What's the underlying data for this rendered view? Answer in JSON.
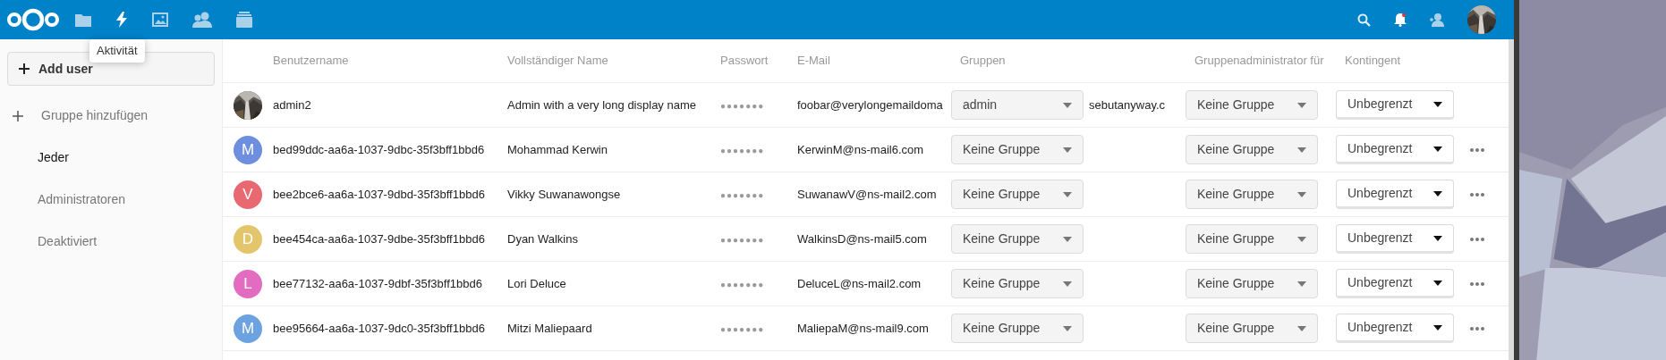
{
  "tooltip": "Aktivität",
  "sidebar": {
    "add_button": "Add user",
    "add_group": "Gruppe hinzufügen",
    "items": [
      {
        "label": "Jeder",
        "selected": true
      },
      {
        "label": "Administratoren",
        "selected": false
      },
      {
        "label": "Deaktiviert",
        "selected": false
      }
    ]
  },
  "table": {
    "columns": [
      "Benutzername",
      "Vollständiger Name",
      "Passwort",
      "E-Mail",
      "Gruppen",
      "Gruppenadministrator für",
      "Kontingent"
    ],
    "rows": [
      {
        "username": "admin2",
        "full_name": "Admin with a very long display name",
        "password": "●●●●●●●",
        "email": "foobar@verylongemaildoma",
        "email_overflow": "sebutanyway.c",
        "groups": "admin",
        "group_admin": "Keine Gruppe",
        "quota": "Unbegrenzt",
        "menu": false
      },
      {
        "avatar": {
          "kind": "letter",
          "letter": "M",
          "color": "#6e8fe0"
        },
        "username": "bed99ddc-aa6a-1037-9dbc-35f3bff1bbd6",
        "full_name": "Mohammad Kerwin",
        "password": "●●●●●●●",
        "email": "KerwinM@ns-mail6.com",
        "groups": "Keine Gruppe",
        "group_admin": "Keine Gruppe",
        "quota": "Unbegrenzt",
        "menu": true
      },
      {
        "avatar": {
          "kind": "letter",
          "letter": "V",
          "color": "#e8696f"
        },
        "username": "bee2bce6-aa6a-1037-9dbd-35f3bff1bbd6",
        "full_name": "Vikky Suwanawongse",
        "password": "●●●●●●●",
        "email": "SuwanawV@ns-mail2.com",
        "groups": "Keine Gruppe",
        "group_admin": "Keine Gruppe",
        "quota": "Unbegrenzt",
        "menu": true
      },
      {
        "avatar": {
          "kind": "letter",
          "letter": "D",
          "color": "#e3c56c"
        },
        "username": "bee454ca-aa6a-1037-9dbe-35f3bff1bbd6",
        "full_name": "Dyan Walkins",
        "password": "●●●●●●●",
        "email": "WalkinsD@ns-mail5.com",
        "groups": "Keine Gruppe",
        "group_admin": "Keine Gruppe",
        "quota": "Unbegrenzt",
        "menu": true
      },
      {
        "avatar": {
          "kind": "letter",
          "letter": "L",
          "color": "#e16cc0"
        },
        "username": "bee77132-aa6a-1037-9dbf-35f3bff1bbd6",
        "full_name": "Lori Deluce",
        "password": "●●●●●●●",
        "email": "DeluceL@ns-mail2.com",
        "groups": "Keine Gruppe",
        "group_admin": "Keine Gruppe",
        "quota": "Unbegrenzt",
        "menu": true
      },
      {
        "avatar": {
          "kind": "letter",
          "letter": "M",
          "color": "#6ca2e0"
        },
        "username": "bee95664-aa6a-1037-9dc0-35f3bff1bbd6",
        "full_name": "Mitzi Maliepaard",
        "password": "●●●●●●●",
        "email": "MaliepaM@ns-mail9.com",
        "groups": "Keine Gruppe",
        "group_admin": "Keine Gruppe",
        "quota": "Unbegrenzt",
        "menu": true
      }
    ]
  }
}
